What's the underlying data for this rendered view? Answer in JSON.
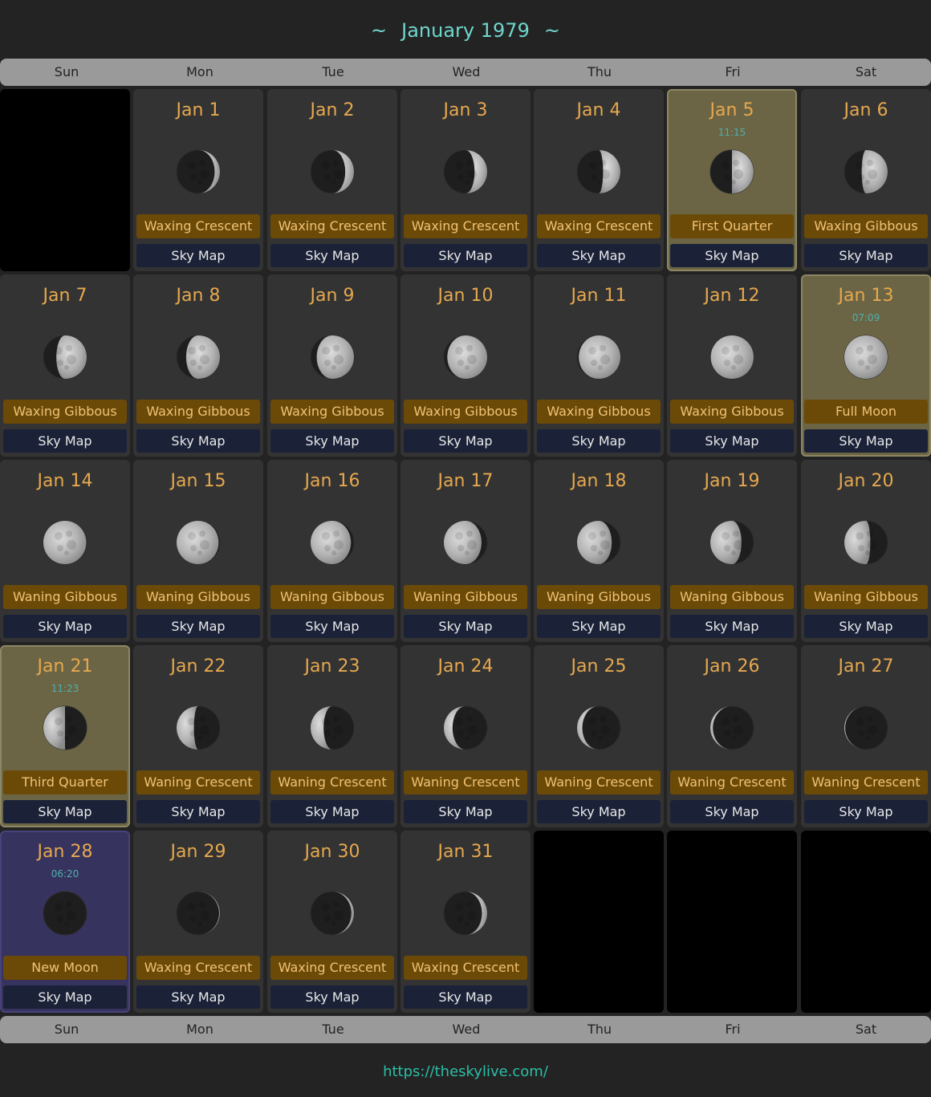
{
  "title": "January 1979",
  "title_decoration": "~",
  "weekdays": [
    "Sun",
    "Mon",
    "Tue",
    "Wed",
    "Thu",
    "Fri",
    "Sat"
  ],
  "sky_map_label": "Sky Map",
  "footer_link": "https://theskylive.com/",
  "colors": {
    "background": "#232323",
    "title": "#6ed6cc",
    "date": "#e6a84e",
    "phase_bg": "#6b4a08",
    "skymap_bg": "#1b2238",
    "major_phase_bg": "#6b6545",
    "new_moon_bg": "#37335f",
    "footer_link": "#2bbfa6"
  },
  "leading_empty_cells": 1,
  "trailing_empty_cells": 3,
  "days": [
    {
      "date": "Jan 1",
      "phase": "Waxing Crescent",
      "illumination": 0.12,
      "waxing": true
    },
    {
      "date": "Jan 2",
      "phase": "Waxing Crescent",
      "illumination": 0.2,
      "waxing": true
    },
    {
      "date": "Jan 3",
      "phase": "Waxing Crescent",
      "illumination": 0.29,
      "waxing": true
    },
    {
      "date": "Jan 4",
      "phase": "Waxing Crescent",
      "illumination": 0.4,
      "waxing": true
    },
    {
      "date": "Jan 5",
      "phase": "First Quarter",
      "time": "11:15",
      "illumination": 0.5,
      "waxing": true,
      "major": true
    },
    {
      "date": "Jan 6",
      "phase": "Waxing Gibbous",
      "illumination": 0.6,
      "waxing": true
    },
    {
      "date": "Jan 7",
      "phase": "Waxing Gibbous",
      "illumination": 0.7,
      "waxing": true
    },
    {
      "date": "Jan 8",
      "phase": "Waxing Gibbous",
      "illumination": 0.78,
      "waxing": true
    },
    {
      "date": "Jan 9",
      "phase": "Waxing Gibbous",
      "illumination": 0.86,
      "waxing": true
    },
    {
      "date": "Jan 10",
      "phase": "Waxing Gibbous",
      "illumination": 0.92,
      "waxing": true
    },
    {
      "date": "Jan 11",
      "phase": "Waxing Gibbous",
      "illumination": 0.96,
      "waxing": true
    },
    {
      "date": "Jan 12",
      "phase": "Waxing Gibbous",
      "illumination": 0.99,
      "waxing": true
    },
    {
      "date": "Jan 13",
      "phase": "Full Moon",
      "time": "07:09",
      "illumination": 1.0,
      "waxing": true,
      "major": true
    },
    {
      "date": "Jan 14",
      "phase": "Waning Gibbous",
      "illumination": 0.99,
      "waxing": false
    },
    {
      "date": "Jan 15",
      "phase": "Waning Gibbous",
      "illumination": 0.97,
      "waxing": false
    },
    {
      "date": "Jan 16",
      "phase": "Waning Gibbous",
      "illumination": 0.93,
      "waxing": false
    },
    {
      "date": "Jan 17",
      "phase": "Waning Gibbous",
      "illumination": 0.87,
      "waxing": false
    },
    {
      "date": "Jan 18",
      "phase": "Waning Gibbous",
      "illumination": 0.8,
      "waxing": false
    },
    {
      "date": "Jan 19",
      "phase": "Waning Gibbous",
      "illumination": 0.72,
      "waxing": false
    },
    {
      "date": "Jan 20",
      "phase": "Waning Gibbous",
      "illumination": 0.6,
      "waxing": false
    },
    {
      "date": "Jan 21",
      "phase": "Third Quarter",
      "time": "11:23",
      "illumination": 0.5,
      "waxing": false,
      "major": true
    },
    {
      "date": "Jan 22",
      "phase": "Waning Crescent",
      "illumination": 0.4,
      "waxing": false
    },
    {
      "date": "Jan 23",
      "phase": "Waning Crescent",
      "illumination": 0.3,
      "waxing": false
    },
    {
      "date": "Jan 24",
      "phase": "Waning Crescent",
      "illumination": 0.2,
      "waxing": false
    },
    {
      "date": "Jan 25",
      "phase": "Waning Crescent",
      "illumination": 0.12,
      "waxing": false
    },
    {
      "date": "Jan 26",
      "phase": "Waning Crescent",
      "illumination": 0.06,
      "waxing": false
    },
    {
      "date": "Jan 27",
      "phase": "Waning Crescent",
      "illumination": 0.02,
      "waxing": false
    },
    {
      "date": "Jan 28",
      "phase": "New Moon",
      "time": "06:20",
      "illumination": 0.0,
      "waxing": true,
      "newmoon": true
    },
    {
      "date": "Jan 29",
      "phase": "Waxing Crescent",
      "illumination": 0.02,
      "waxing": true
    },
    {
      "date": "Jan 30",
      "phase": "Waxing Crescent",
      "illumination": 0.06,
      "waxing": true
    },
    {
      "date": "Jan 31",
      "phase": "Waxing Crescent",
      "illumination": 0.12,
      "waxing": true
    }
  ]
}
